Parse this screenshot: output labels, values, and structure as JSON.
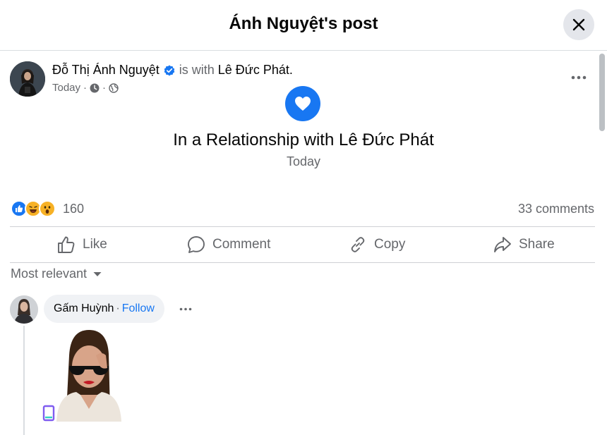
{
  "header": {
    "title": "Ánh Nguyệt's post"
  },
  "post": {
    "author": "Đỗ Thị Ánh Nguyệt",
    "with_text": "is with",
    "tagged": "Lê Đức Phát",
    "tagged_suffix": ".",
    "time": "Today",
    "sep": "·",
    "event": {
      "title": "In a Relationship with Lê Đức Phát",
      "date": "Today"
    }
  },
  "stats": {
    "reaction_count": "160",
    "comments": "33 comments"
  },
  "actions": {
    "like": "Like",
    "comment": "Comment",
    "copy": "Copy",
    "share": "Share"
  },
  "sort": {
    "label": "Most relevant"
  },
  "comment": {
    "author": "Gấm Huỳnh",
    "sep": "·",
    "follow": "Follow"
  },
  "colors": {
    "accent": "#1877f2",
    "secondary_text": "#65676b",
    "bubble": "#f0f2f5"
  },
  "icons": [
    "close-icon",
    "verified-icon",
    "clock-icon",
    "globe-icon",
    "more-icon",
    "heart-icon",
    "like-reaction-icon",
    "haha-reaction-icon",
    "wow-reaction-icon",
    "thumbs-up-icon",
    "comment-icon",
    "link-icon",
    "share-icon",
    "caret-down-icon"
  ]
}
